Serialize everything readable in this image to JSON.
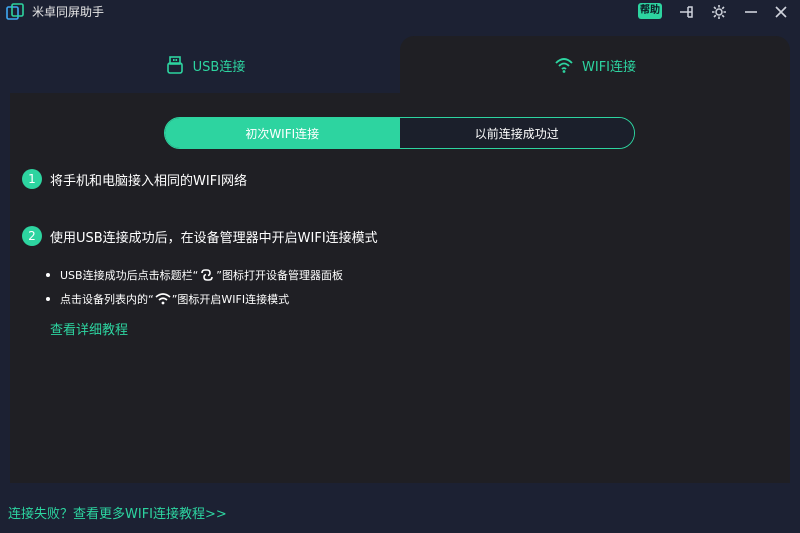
{
  "app": {
    "title": "米卓同屏助手",
    "help_label": "帮助",
    "accent_color": "#2dd4a0",
    "icons": [
      "app-logo-icon",
      "pin-icon",
      "gear-icon",
      "minimize-icon",
      "close-icon"
    ]
  },
  "tabs": [
    {
      "label": "USB连接",
      "icon": "usb-icon",
      "selected": false
    },
    {
      "label": "WIFI连接",
      "icon": "wifi-icon",
      "selected": true
    }
  ],
  "mode_toggle": {
    "options": [
      "初次WIFI连接",
      "以前连接成功过"
    ],
    "selected": "初次WIFI连接"
  },
  "steps": [
    {
      "number": "1",
      "text": "将手机和电脑接入相同的WIFI网络"
    },
    {
      "number": "2",
      "text": "使用USB连接成功后，在设备管理器中开启WIFI连接模式"
    }
  ],
  "bullets": [
    {
      "before": "USB连接成功后点击标题栏“",
      "icon": "link-icon",
      "after": "”图标打开设备管理器面板"
    },
    {
      "before": "点击设备列表内的“",
      "icon": "wifi-icon",
      "after": "”图标开启WIFI连接模式"
    }
  ],
  "detail_link": "查看详细教程",
  "footer_link": "连接失败？查看更多WIFI连接教程>>"
}
